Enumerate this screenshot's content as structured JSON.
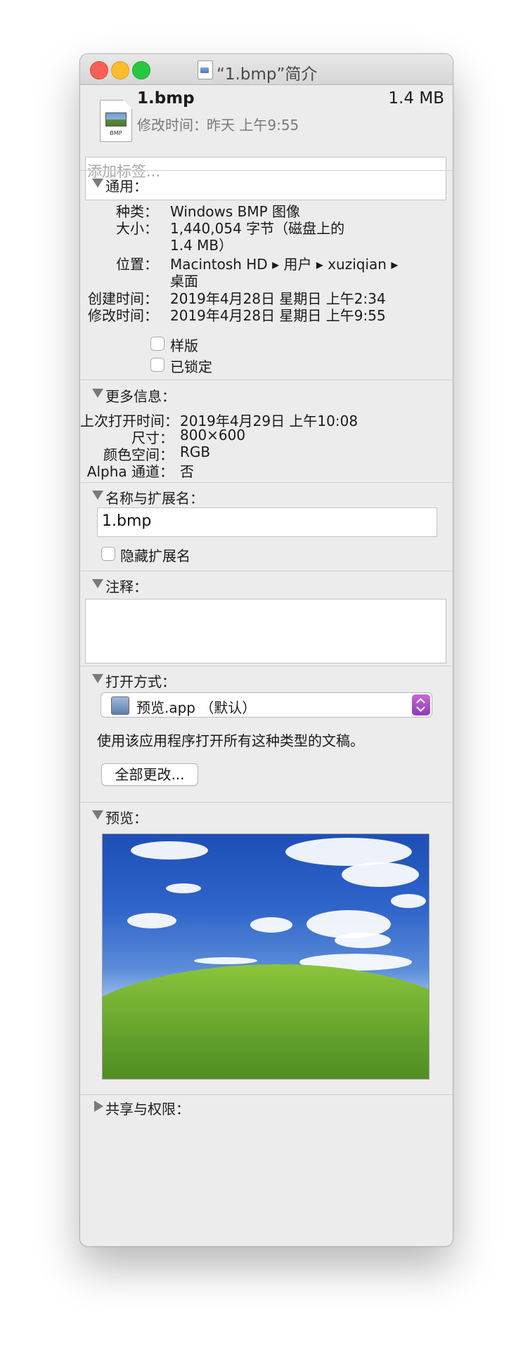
{
  "window": {
    "title": "“1.bmp”简介"
  },
  "header": {
    "file_name": "1.bmp",
    "file_size": "1.4 MB",
    "modified_label": "修改时间：",
    "modified_value": "昨天 上午9:55",
    "icon_label": "BMP"
  },
  "tags": {
    "placeholder": "添加标签..."
  },
  "general": {
    "title": "通用：",
    "rows": [
      {
        "label": "种类：",
        "value": "Windows BMP 图像"
      },
      {
        "label": "大小：",
        "value": "1,440,054 字节（磁盘上的",
        "value2": "1.4 MB）"
      },
      {
        "label": "位置：",
        "value": "Macintosh HD ▸ 用户 ▸ xuziqian ▸",
        "value2": "桌面"
      },
      {
        "label": "创建时间：",
        "value": "2019年4月28日 星期日 上午2:34"
      },
      {
        "label": "修改时间：",
        "value": "2019年4月28日 星期日 上午9:55"
      }
    ],
    "checkboxes": [
      {
        "label": "样版",
        "checked": false
      },
      {
        "label": "已锁定",
        "checked": false
      }
    ]
  },
  "more_info": {
    "title": "更多信息：",
    "rows": [
      {
        "label": "上次打开时间：",
        "value": "2019年4月29日 上午10:08"
      },
      {
        "label": "尺寸：",
        "value": "800×600"
      },
      {
        "label": "颜色空间：",
        "value": "RGB"
      },
      {
        "label": "Alpha 通道：",
        "value": "否"
      }
    ]
  },
  "name_ext": {
    "title": "名称与扩展名：",
    "value": "1.bmp",
    "hide_ext_label": "隐藏扩展名",
    "hide_ext_checked": false
  },
  "comments": {
    "title": "注释：",
    "value": ""
  },
  "open_with": {
    "title": "打开方式：",
    "selected_app": "预览.app （默认）",
    "description": "使用该应用程序打开所有这种类型的文稿。",
    "change_all_label": "全部更改..."
  },
  "preview": {
    "title": "预览："
  },
  "sharing": {
    "title": "共享与权限："
  },
  "colors": {
    "close": "#fc5f57",
    "minimize": "#fdbc2e",
    "zoom": "#27c840",
    "stepper_accent": "#a64fc7"
  }
}
